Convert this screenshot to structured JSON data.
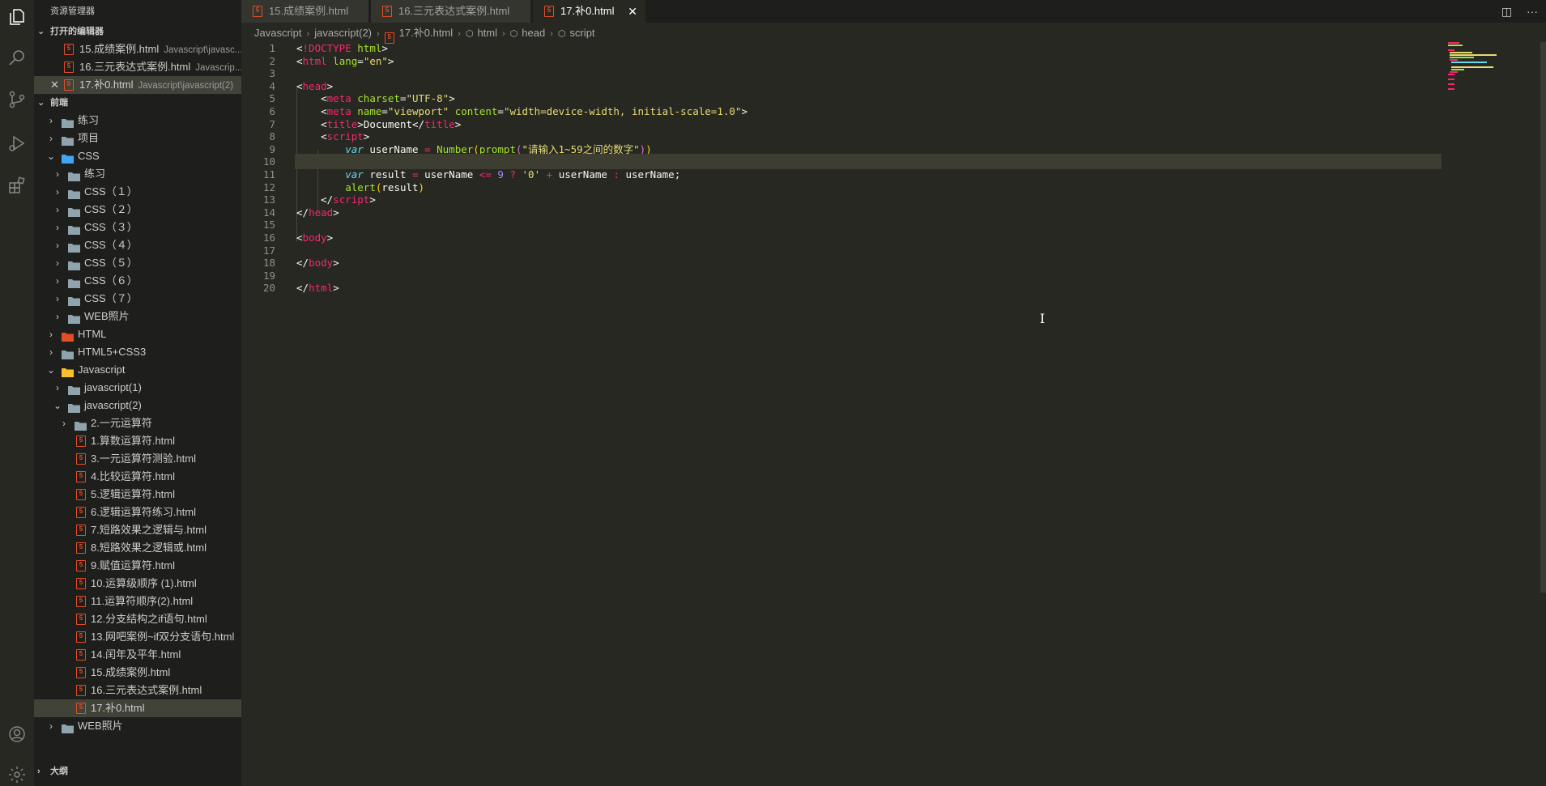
{
  "activity_bar": {
    "icons": [
      "files-icon",
      "search-icon",
      "source-control-icon",
      "run-debug-icon",
      "extensions-icon",
      "account-icon",
      "settings-gear-icon"
    ]
  },
  "sidebar": {
    "title": "资源管理器",
    "open_editors": {
      "heading": "打开的编辑器",
      "items": [
        {
          "name": "15.成绩案例.html",
          "path": "Javascript\\javasc..."
        },
        {
          "name": "16.三元表达式案例.html",
          "path": "Javascrip..."
        },
        {
          "name": "17.补0.html",
          "path": "Javascript\\javascript(2)"
        }
      ]
    },
    "workspace": {
      "heading": "前端",
      "tree": [
        {
          "label": "练习",
          "type": "folder",
          "depth": 1,
          "open": false
        },
        {
          "label": "项目",
          "type": "folder",
          "depth": 1,
          "open": false
        },
        {
          "label": "CSS",
          "type": "folder-css",
          "depth": 1,
          "open": true
        },
        {
          "label": "练习",
          "type": "folder",
          "depth": 2,
          "open": false
        },
        {
          "label": "CSS（１）",
          "type": "folder",
          "depth": 2,
          "open": false
        },
        {
          "label": "CSS（２）",
          "type": "folder",
          "depth": 2,
          "open": false
        },
        {
          "label": "CSS（３）",
          "type": "folder",
          "depth": 2,
          "open": false
        },
        {
          "label": "CSS（４）",
          "type": "folder",
          "depth": 2,
          "open": false
        },
        {
          "label": "CSS（５）",
          "type": "folder",
          "depth": 2,
          "open": false
        },
        {
          "label": "CSS（６）",
          "type": "folder",
          "depth": 2,
          "open": false
        },
        {
          "label": "CSS（７）",
          "type": "folder",
          "depth": 2,
          "open": false
        },
        {
          "label": "WEB照片",
          "type": "folder",
          "depth": 2,
          "open": false
        },
        {
          "label": "HTML",
          "type": "folder-html",
          "depth": 1,
          "open": false
        },
        {
          "label": "HTML5+CSS3",
          "type": "folder",
          "depth": 1,
          "open": false
        },
        {
          "label": "Javascript",
          "type": "folder-js",
          "depth": 1,
          "open": true
        },
        {
          "label": "javascript(1)",
          "type": "folder",
          "depth": 2,
          "open": false
        },
        {
          "label": "javascript(2)",
          "type": "folder-open",
          "depth": 2,
          "open": true
        },
        {
          "label": "2.一元运算符",
          "type": "folder",
          "depth": 3,
          "open": false
        },
        {
          "label": "1.算数运算符.html",
          "type": "html",
          "depth": 3
        },
        {
          "label": "3.一元运算符测验.html",
          "type": "html",
          "depth": 3
        },
        {
          "label": "4.比较运算符.html",
          "type": "html",
          "depth": 3
        },
        {
          "label": "5.逻辑运算符.html",
          "type": "html",
          "depth": 3
        },
        {
          "label": "6.逻辑运算符练习.html",
          "type": "html",
          "depth": 3
        },
        {
          "label": "7.短路效果之逻辑与.html",
          "type": "html",
          "depth": 3
        },
        {
          "label": "8.短路效果之逻辑或.html",
          "type": "html",
          "depth": 3
        },
        {
          "label": "9.赋值运算符.html",
          "type": "html",
          "depth": 3
        },
        {
          "label": "10.运算级顺序 (1).html",
          "type": "html",
          "depth": 3
        },
        {
          "label": "11.运算符顺序(2).html",
          "type": "html",
          "depth": 3
        },
        {
          "label": "12.分支结构之if语句.html",
          "type": "html",
          "depth": 3
        },
        {
          "label": "13.网吧案例~if双分支语句.html",
          "type": "html",
          "depth": 3
        },
        {
          "label": "14.闰年及平年.html",
          "type": "html",
          "depth": 3
        },
        {
          "label": "15.成绩案例.html",
          "type": "html",
          "depth": 3
        },
        {
          "label": "16.三元表达式案例.html",
          "type": "html",
          "depth": 3
        },
        {
          "label": "17.补0.html",
          "type": "html",
          "depth": 3,
          "selected": true
        },
        {
          "label": "WEB照片",
          "type": "folder",
          "depth": 1,
          "open": false
        }
      ]
    },
    "outline_heading": "大纲"
  },
  "tabs": [
    {
      "label": "15.成绩案例.html",
      "active": false
    },
    {
      "label": "16.三元表达式案例.html",
      "active": false
    },
    {
      "label": "17.补0.html",
      "active": true
    }
  ],
  "breadcrumb": [
    "Javascript",
    "javascript(2)",
    "17.补0.html",
    "html",
    "head",
    "script"
  ],
  "editor": {
    "current_line": 10,
    "lines": [
      [
        [
          "t-punct",
          "<"
        ],
        [
          "t-tag",
          "!DOCTYPE"
        ],
        [
          "t-text",
          " "
        ],
        [
          "t-attr",
          "html"
        ],
        [
          "t-punct",
          ">"
        ]
      ],
      [
        [
          "t-punct",
          "<"
        ],
        [
          "t-tag",
          "html"
        ],
        [
          "t-text",
          " "
        ],
        [
          "t-attr",
          "lang"
        ],
        [
          "t-punct",
          "="
        ],
        [
          "t-str",
          "\"en\""
        ],
        [
          "t-punct",
          ">"
        ]
      ],
      [],
      [
        [
          "t-punct",
          "<"
        ],
        [
          "t-tag",
          "head"
        ],
        [
          "t-punct",
          ">"
        ]
      ],
      [
        [
          "t-text",
          "    "
        ],
        [
          "t-punct",
          "<"
        ],
        [
          "t-tag",
          "meta"
        ],
        [
          "t-text",
          " "
        ],
        [
          "t-attr",
          "charset"
        ],
        [
          "t-punct",
          "="
        ],
        [
          "t-str",
          "\"UTF-8\""
        ],
        [
          "t-punct",
          ">"
        ]
      ],
      [
        [
          "t-text",
          "    "
        ],
        [
          "t-punct",
          "<"
        ],
        [
          "t-tag",
          "meta"
        ],
        [
          "t-text",
          " "
        ],
        [
          "t-attr",
          "name"
        ],
        [
          "t-punct",
          "="
        ],
        [
          "t-str",
          "\"viewport\""
        ],
        [
          "t-text",
          " "
        ],
        [
          "t-attr",
          "content"
        ],
        [
          "t-punct",
          "="
        ],
        [
          "t-str",
          "\"width=device-width, initial-scale=1.0\""
        ],
        [
          "t-punct",
          ">"
        ]
      ],
      [
        [
          "t-text",
          "    "
        ],
        [
          "t-punct",
          "<"
        ],
        [
          "t-tag",
          "title"
        ],
        [
          "t-punct",
          ">"
        ],
        [
          "t-text",
          "Document"
        ],
        [
          "t-punct",
          "</"
        ],
        [
          "t-tag",
          "title"
        ],
        [
          "t-punct",
          ">"
        ]
      ],
      [
        [
          "t-text",
          "    "
        ],
        [
          "t-punct",
          "<"
        ],
        [
          "t-tag",
          "script"
        ],
        [
          "t-punct",
          ">"
        ]
      ],
      [
        [
          "t-text",
          "        "
        ],
        [
          "t-kw",
          "var"
        ],
        [
          "t-text",
          " userName "
        ],
        [
          "t-op",
          "="
        ],
        [
          "t-text",
          " "
        ],
        [
          "t-fn",
          "Number"
        ],
        [
          "t-brkt",
          "("
        ],
        [
          "t-fn",
          "prompt"
        ],
        [
          "t-brkt2",
          "("
        ],
        [
          "t-str",
          "\"请输入1~59之间的数字\""
        ],
        [
          "t-brkt2",
          ")"
        ],
        [
          "t-brkt",
          ")"
        ]
      ],
      [],
      [
        [
          "t-text",
          "        "
        ],
        [
          "t-kw",
          "var"
        ],
        [
          "t-text",
          " result "
        ],
        [
          "t-op",
          "="
        ],
        [
          "t-text",
          " userName "
        ],
        [
          "t-op",
          "<="
        ],
        [
          "t-text",
          " "
        ],
        [
          "t-num",
          "9"
        ],
        [
          "t-text",
          " "
        ],
        [
          "t-op",
          "?"
        ],
        [
          "t-text",
          " "
        ],
        [
          "t-str",
          "'0'"
        ],
        [
          "t-text",
          " "
        ],
        [
          "t-op",
          "+"
        ],
        [
          "t-text",
          " userName "
        ],
        [
          "t-op",
          ":"
        ],
        [
          "t-text",
          " userName;"
        ]
      ],
      [
        [
          "t-text",
          "        "
        ],
        [
          "t-fn",
          "alert"
        ],
        [
          "t-brkt",
          "("
        ],
        [
          "t-text",
          "result"
        ],
        [
          "t-brkt",
          ")"
        ]
      ],
      [
        [
          "t-text",
          "    "
        ],
        [
          "t-punct",
          "</"
        ],
        [
          "t-tag",
          "script"
        ],
        [
          "t-punct",
          ">"
        ]
      ],
      [
        [
          "t-punct",
          "</"
        ],
        [
          "t-tag",
          "head"
        ],
        [
          "t-punct",
          ">"
        ]
      ],
      [],
      [
        [
          "t-punct",
          "<"
        ],
        [
          "t-tag",
          "body"
        ],
        [
          "t-punct",
          ">"
        ]
      ],
      [],
      [
        [
          "t-punct",
          "</"
        ],
        [
          "t-tag",
          "body"
        ],
        [
          "t-punct",
          ">"
        ]
      ],
      [],
      [
        [
          "t-punct",
          "</"
        ],
        [
          "t-tag",
          "html"
        ],
        [
          "t-punct",
          ">"
        ]
      ]
    ]
  },
  "colors": {
    "editor_bg": "#272822",
    "sidebar_bg": "#1e1f1c",
    "selection_bg": "#414339",
    "html_icon": "#e44d26"
  }
}
